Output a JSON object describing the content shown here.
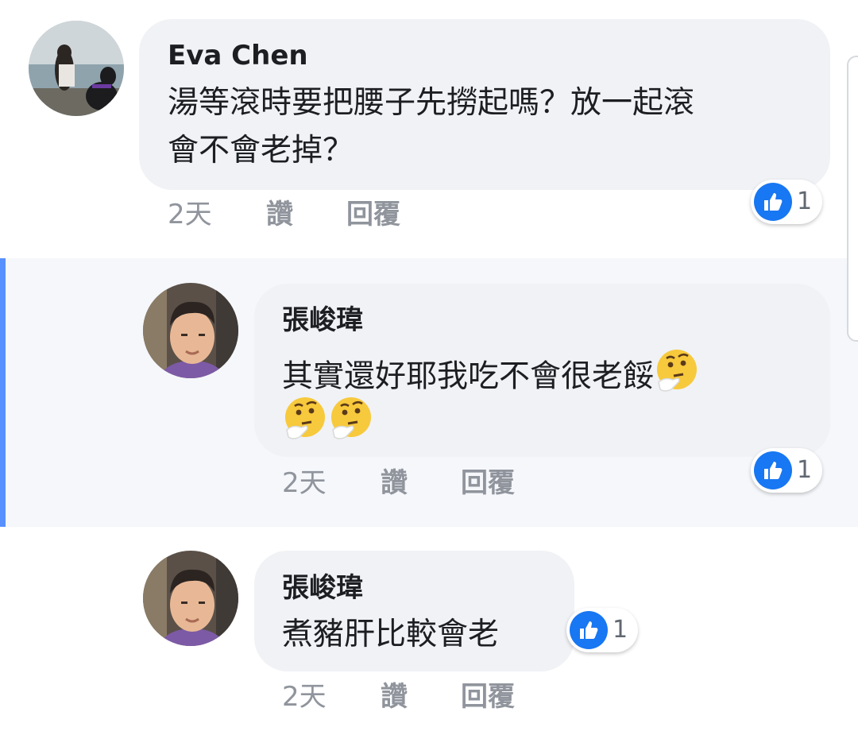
{
  "comments": [
    {
      "author": "Eva Chen",
      "text_lines": [
        "湯等滾時要把腰子先撈起嗎？放一起滾",
        "會不會老掉？"
      ],
      "time": "2天",
      "like_label": "讚",
      "reply_label": "回覆",
      "reaction_count": "1"
    },
    {
      "author": "張峻瑋",
      "text_line1": "其實還好耶我吃不會很老餒",
      "emoji": "thinking-face",
      "time": "2天",
      "like_label": "讚",
      "reply_label": "回覆",
      "reaction_count": "1",
      "highlighted": true
    },
    {
      "author": "張峻瑋",
      "text": "煮豬肝比較會老",
      "time": "2天",
      "like_label": "讚",
      "reply_label": "回覆",
      "reaction_count": "1"
    }
  ],
  "colors": {
    "bubble": "#f0f2f5",
    "highlight_bg": "#f5f7fb",
    "highlight_bar": "#5890ff",
    "like_blue": "#1877f2",
    "meta_gray": "#90949c"
  },
  "icons": [
    "like-thumb-icon",
    "thinking-face-emoji"
  ]
}
